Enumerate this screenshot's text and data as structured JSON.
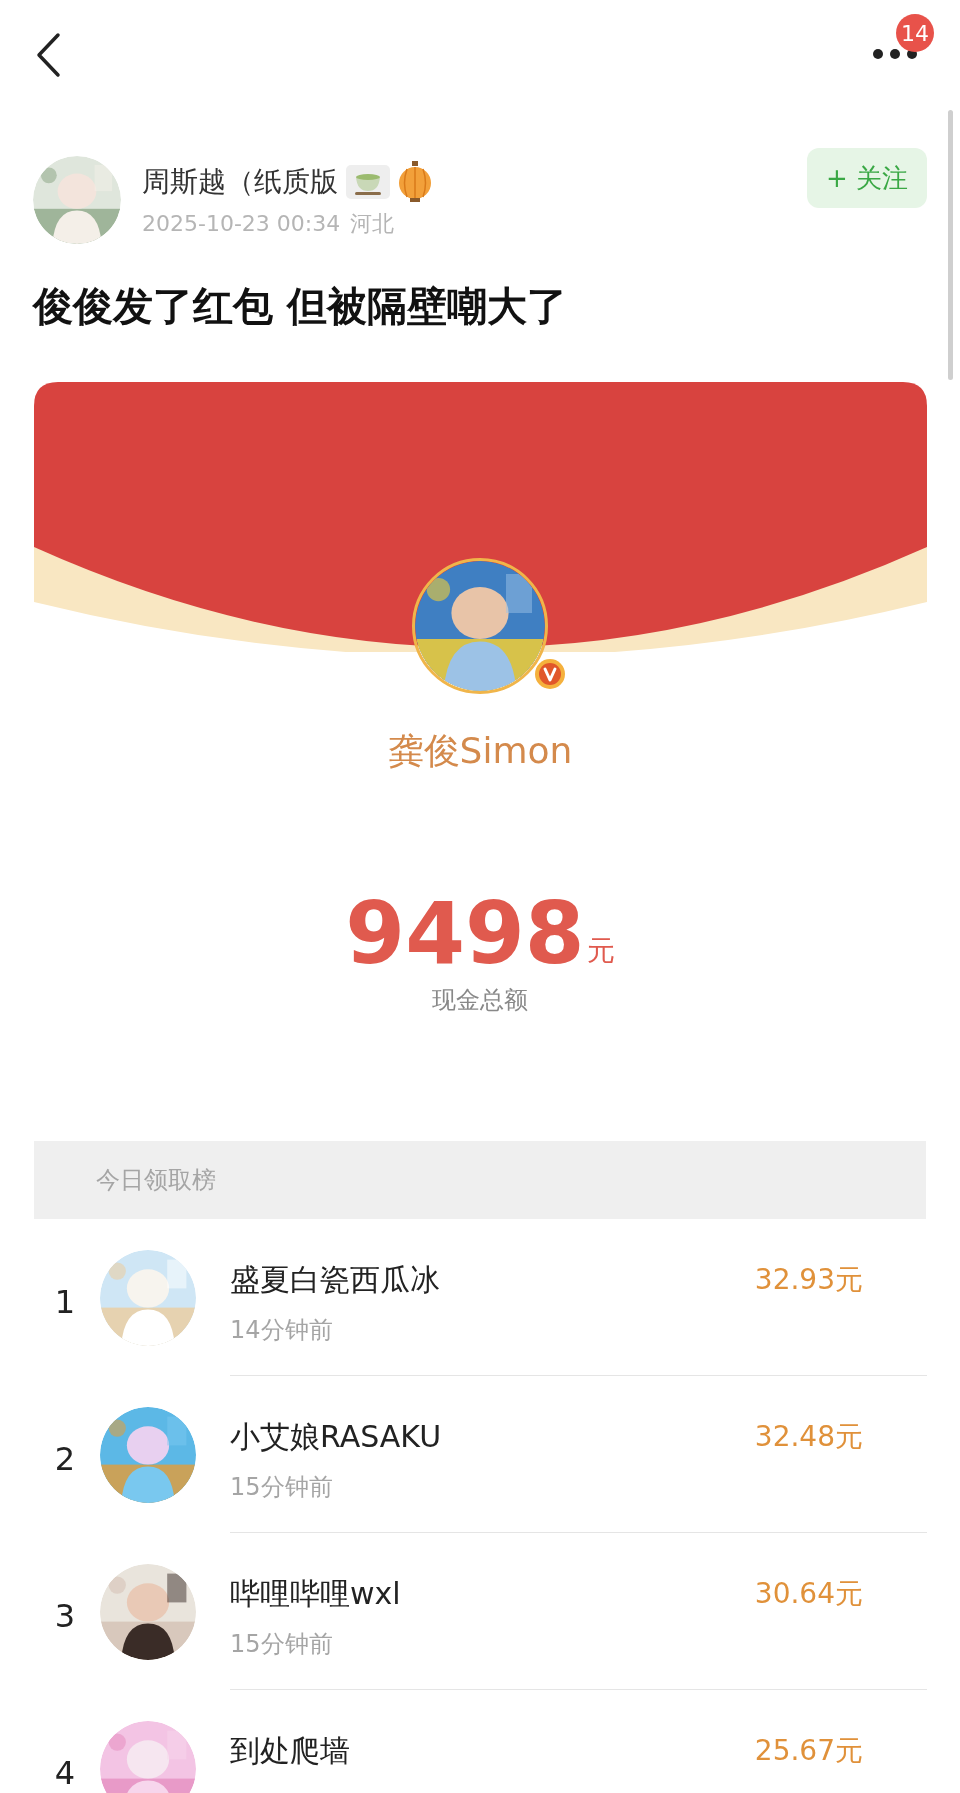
{
  "nav": {
    "badge": "14"
  },
  "post": {
    "author": "周斯越（纸质版",
    "date": "2025-10-23 00:34",
    "location": "河北",
    "follow": "+ 关注",
    "title": "俊俊发了红包 但被隔壁嘲大了"
  },
  "red_packet": {
    "sender": "龚俊Simon",
    "verified": true,
    "amount": "9498",
    "unit": "元",
    "amount_label": "现金总额"
  },
  "leaderboard": {
    "title": "今日领取榜",
    "rows": [
      {
        "rank": "1",
        "name": "盛夏白瓷西瓜冰",
        "time": "14分钟前",
        "amount": "32.93元"
      },
      {
        "rank": "2",
        "name": "小艾娘RASAKU",
        "time": "15分钟前",
        "amount": "32.48元"
      },
      {
        "rank": "3",
        "name": "哔哩哔哩wxl",
        "time": "15分钟前",
        "amount": "30.64元"
      },
      {
        "rank": "4",
        "name": "到处爬墙",
        "amount": "25.67元"
      }
    ]
  }
}
